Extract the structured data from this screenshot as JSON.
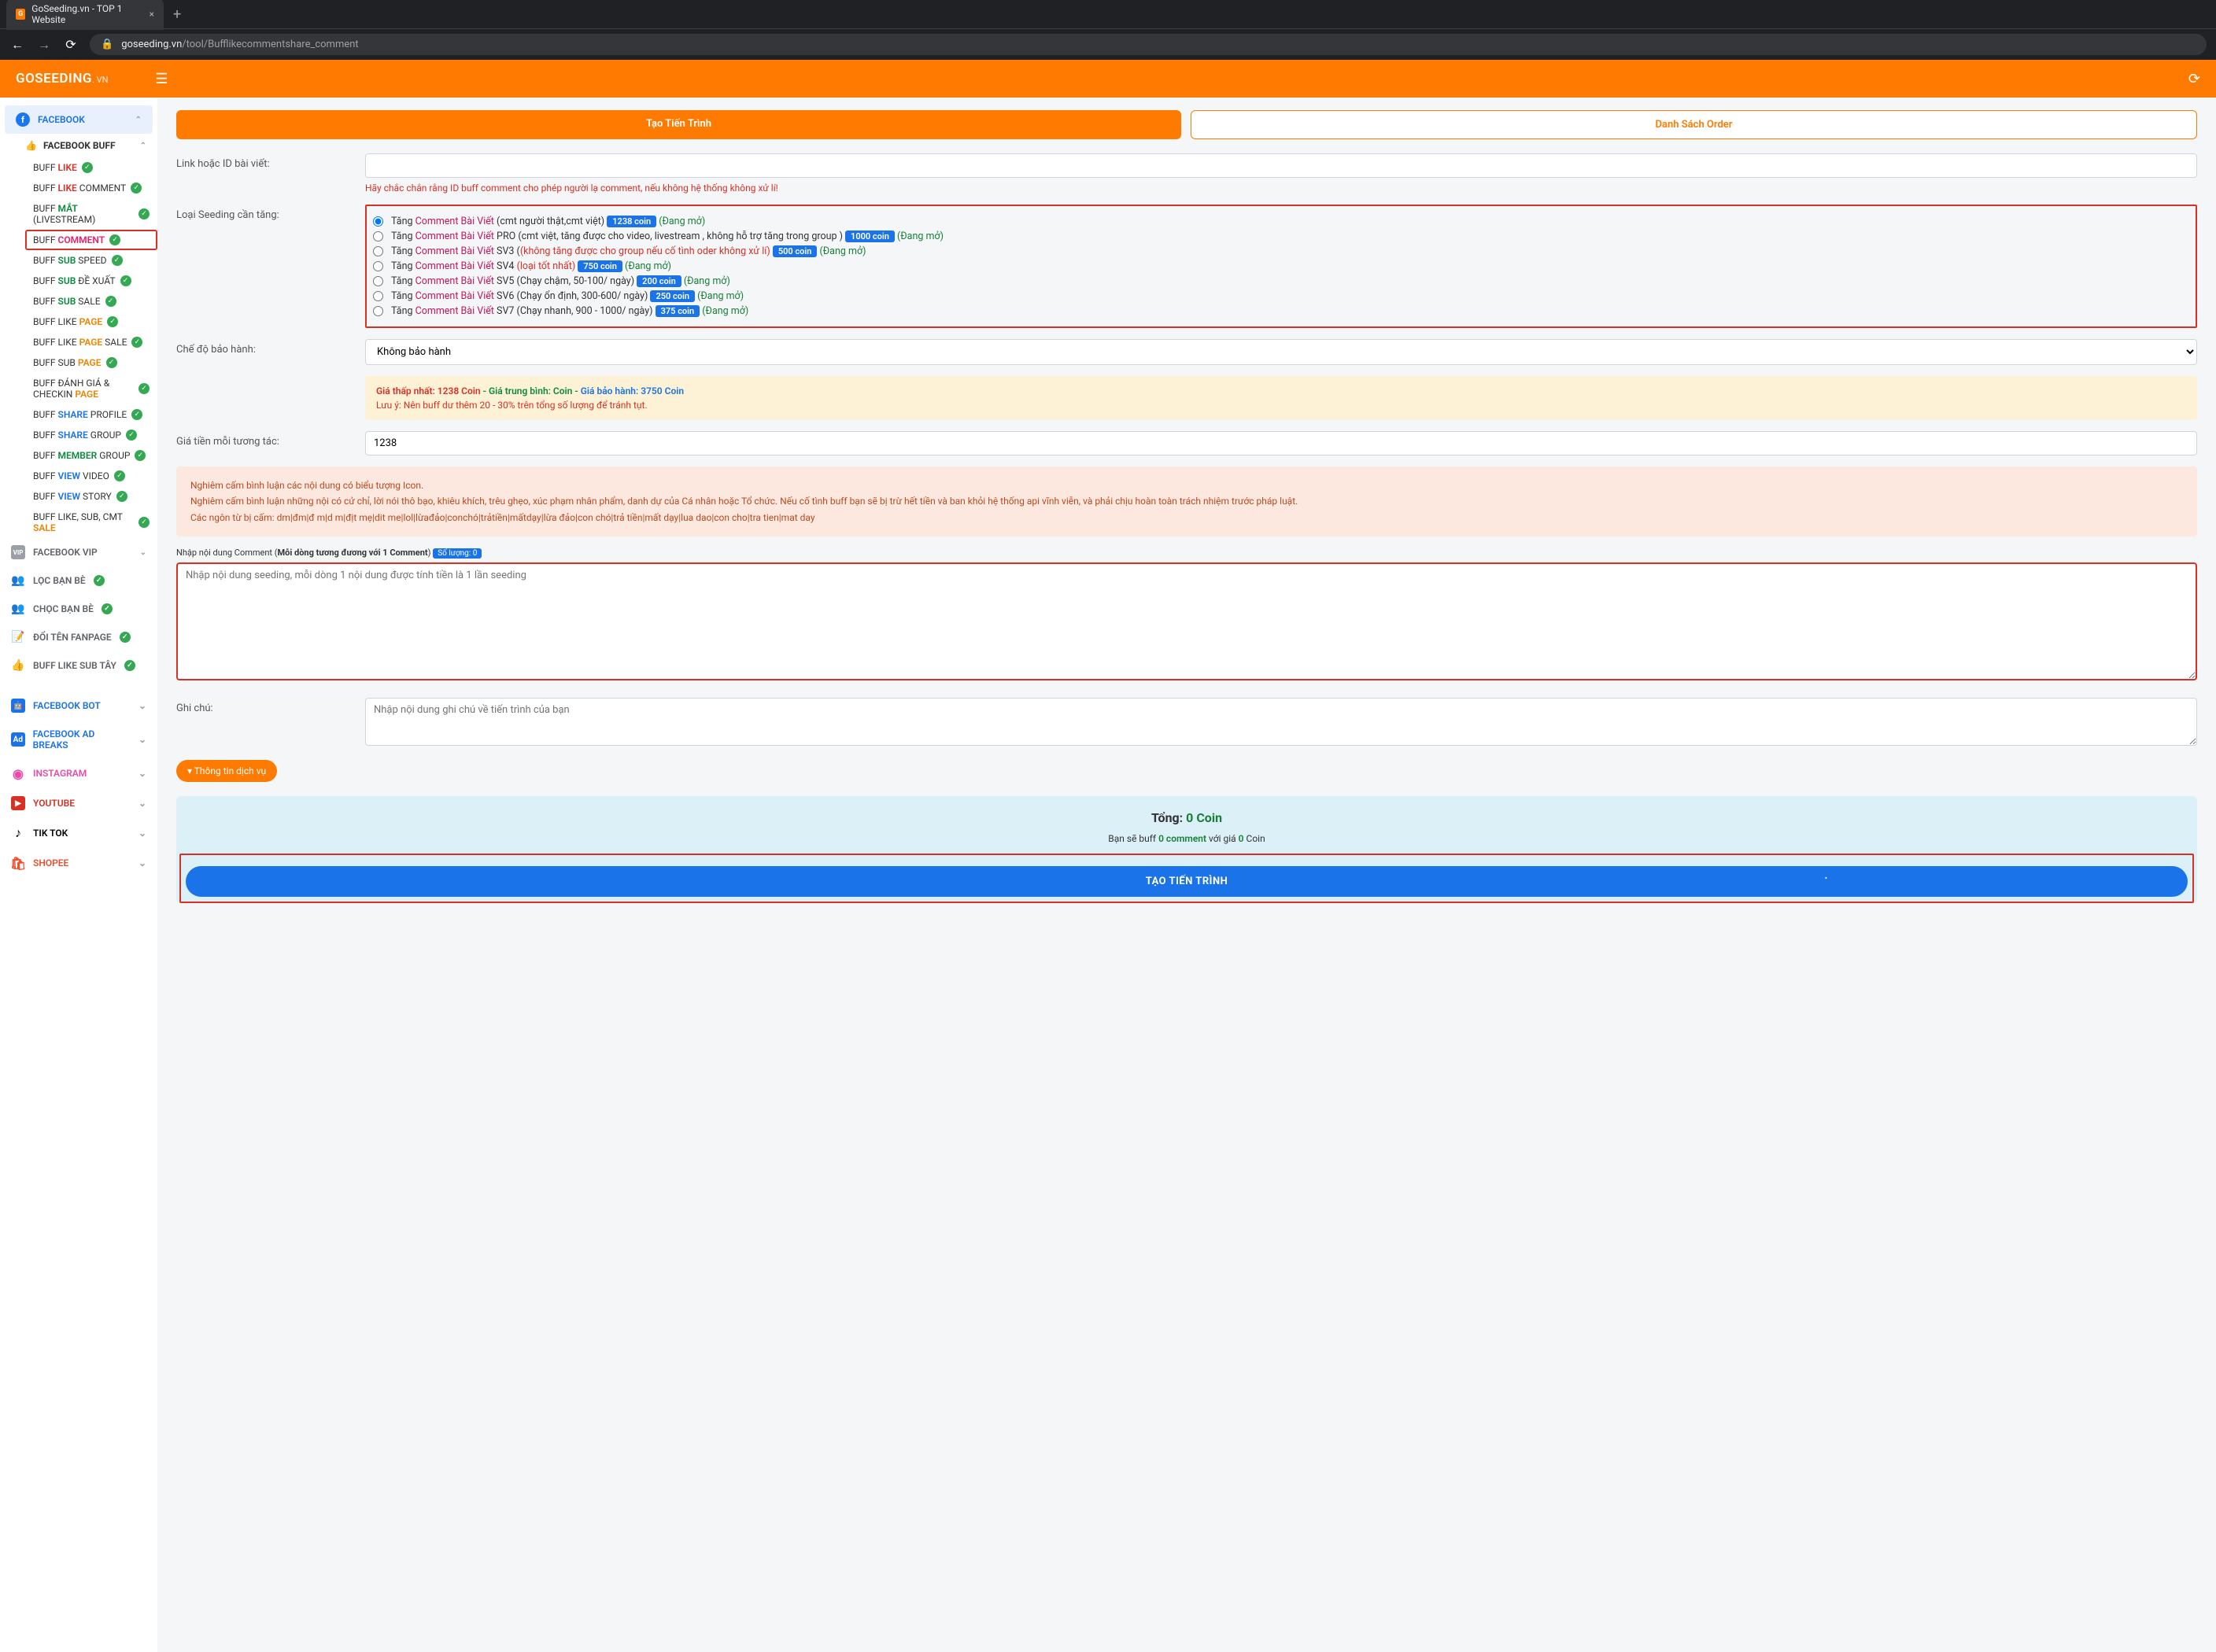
{
  "browser": {
    "tab_title": "GoSeeding.vn - TOP 1 Website",
    "url_host": "goseeding.vn",
    "url_path": "/tool/Bufflikecommentshare_comment"
  },
  "header": {
    "brand": "GOSEEDING",
    "brand_tld": ". VN"
  },
  "sidebar": {
    "facebook": "FACEBOOK",
    "facebook_buff": "FACEBOOK BUFF",
    "items": [
      {
        "pre": "BUFF ",
        "em": "LIKE",
        "post": "",
        "cls": "c-red"
      },
      {
        "pre": "BUFF ",
        "em": "LIKE",
        "post": " COMMENT",
        "cls": "c-red"
      },
      {
        "pre": "BUFF ",
        "em": "MẮT",
        "post": " (LIVESTREAM)",
        "cls": "c-green2"
      },
      {
        "pre": "BUFF ",
        "em": "COMMENT",
        "post": "",
        "cls": "c-pink",
        "hl": true
      },
      {
        "pre": "BUFF ",
        "em": "SUB",
        "post": " SPEED",
        "cls": "c-green2"
      },
      {
        "pre": "BUFF ",
        "em": "SUB",
        "post": " ĐỀ XUẤT",
        "cls": "c-green2"
      },
      {
        "pre": "BUFF ",
        "em": "SUB",
        "post": " SALE",
        "cls": "c-green2"
      },
      {
        "pre": "BUFF LIKE ",
        "em": "PAGE",
        "post": "",
        "cls": "c-orange"
      },
      {
        "pre": "BUFF LIKE ",
        "em": "PAGE",
        "post": " SALE",
        "cls": "c-orange"
      },
      {
        "pre": "BUFF SUB ",
        "em": "PAGE",
        "post": "",
        "cls": "c-orange"
      },
      {
        "pre": "BUFF ĐÁNH GIÁ & CHECKIN ",
        "em": "PAGE",
        "post": "",
        "cls": "c-orange",
        "multi": true
      },
      {
        "pre": "BUFF ",
        "em": "SHARE",
        "post": " PROFILE",
        "cls": "c-blue"
      },
      {
        "pre": "BUFF ",
        "em": "SHARE",
        "post": " GROUP",
        "cls": "c-blue"
      },
      {
        "pre": "BUFF ",
        "em": "MEMBER",
        "post": " GROUP",
        "cls": "c-green2"
      },
      {
        "pre": "BUFF ",
        "em": "VIEW",
        "post": " VIDEO",
        "cls": "c-blue"
      },
      {
        "pre": "BUFF ",
        "em": "VIEW",
        "post": " STORY",
        "cls": "c-blue"
      },
      {
        "pre": "BUFF LIKE, SUB, CMT ",
        "em": "SALE",
        "post": "",
        "cls": "c-orange"
      }
    ],
    "fb_vip": "FACEBOOK VIP",
    "loc_ban_be": "LỌC BẠN BÈ",
    "choc_ban_be": "CHỌC BẠN BÈ",
    "doi_ten": "ĐỔI TÊN FANPAGE",
    "buff_like_sub_tay": "BUFF LIKE SUB TÂY",
    "fb_bot": "FACEBOOK BOT",
    "fb_ad": "FACEBOOK AD BREAKS",
    "instagram": "INSTAGRAM",
    "youtube": "YOUTUBE",
    "tiktok": "TIK TOK",
    "shopee": "SHOPEE"
  },
  "tabs": {
    "create": "Tạo Tiến Trình",
    "orders": "Danh Sách Order"
  },
  "form": {
    "link_label": "Link hoặc ID bài viết:",
    "link_hint": "Hãy chắc chắn rằng ID buff comment cho phép người lạ comment, nếu không hệ thống không xử lí!",
    "seeding_label": "Loại Seeding cần tăng:",
    "warranty_label": "Chế độ bảo hành:",
    "warranty_value": "Không bảo hành",
    "price_label": "Giá tiền mỗi tương tác:",
    "price_value": "1238",
    "note_label": "Ghi chú:",
    "note_placeholder": "Nhập nội dung ghi chú về tiến trình của bạn"
  },
  "options": [
    {
      "pre": "Tăng ",
      "link": "Comment Bài Viết",
      "desc": " (cmt người thật,cmt việt) ",
      "coin": "1238 coin",
      "status": "(Đang mở)",
      "checked": true
    },
    {
      "pre": "Tăng ",
      "link": "Comment Bài Viết",
      "desc": " PRO (cmt việt, tăng được cho video, livestream , không hỗ trợ tăng trong group ) ",
      "coin": "1000 coin",
      "status": "(Đang mở)"
    },
    {
      "pre": "Tăng ",
      "link": "Comment Bài Viết",
      "desc": " SV3 (",
      "desc_red": "(không tăng được cho group nếu cố tình oder không xử lí)",
      "coin": "500 coin",
      "status": "(Đang mở)"
    },
    {
      "pre": "Tăng ",
      "link": "Comment Bài Viết",
      "desc": " SV4 ",
      "desc_red": "(loại tốt nhất)",
      "coin": "750 coin",
      "status": "(Đang mở)"
    },
    {
      "pre": "Tăng ",
      "link": "Comment Bài Viết",
      "desc": " SV5 (Chạy chậm, 50-100/ ngày) ",
      "coin": "200 coin",
      "status": "(Đang mở)"
    },
    {
      "pre": "Tăng ",
      "link": "Comment Bài Viết",
      "desc": " SV6 (Chạy ổn định, 300-600/ ngày) ",
      "coin": "250 coin",
      "status": "(Đang mở)"
    },
    {
      "pre": "Tăng ",
      "link": "Comment Bài Viết",
      "desc": " SV7 (Chạy nhanh, 900 - 1000/ ngày) ",
      "coin": "375 coin",
      "status": "(Đang mở)"
    }
  ],
  "info": {
    "low": "Giá thấp nhất: 1238 Coin",
    "sep": "  -  ",
    "avg": "Giá trung bình: Coin",
    "sep2": "  -  ",
    "warranty": "Giá bảo hành: 3750 Coin",
    "note": "Lưu ý: Nên buff dư thêm 20 - 30% trên tổng số lượng để tránh tụt."
  },
  "warn": {
    "l1": "Nghiêm cấm bình luận các nội dung có biểu tượng Icon.",
    "l2": "Nghiêm cấm bình luận những nội có cử chỉ, lời nói thô bạo, khiêu khích, trêu ghẹo, xúc phạm nhân phẩm, danh dự của Cá nhân hoặc Tổ chức. Nếu cố tình buff bạn sẽ bị trừ hết tiền và ban khỏi hệ thống api vĩnh viễn, và phải chịu hoàn toàn trách nhiệm trước pháp luật.",
    "l3": "Các ngôn từ bị cấm: dm|đm|đ m|d m|địt mẹ|dit me|lol|lừađảo|conchó|trảtiền|mấtdạy|lừa đảo|con chó|trả tiền|mất dạy|lua dao|con cho|tra tien|mat day"
  },
  "comment": {
    "header_pre": "Nhập nội dung Comment (",
    "header_bold": "Mỗi dòng tương đương với 1 Comment",
    "header_post": ") ",
    "count_pill": "Số lượng: 0",
    "placeholder": "Nhập nội dung seeding, mỗi dòng 1 nội dung được tính tiền là 1 lần seeding"
  },
  "service_btn": "▾ Thông tin dịch vụ",
  "total": {
    "label": "Tổng: ",
    "amount": "0 Coin",
    "sub_pre": "Bạn sẽ buff ",
    "sub_cmt": "0 comment",
    "sub_mid": " với giá ",
    "sub_coin": "0",
    "sub_post": " Coin",
    "submit": "TẠO TIẾN TRÌNH"
  }
}
